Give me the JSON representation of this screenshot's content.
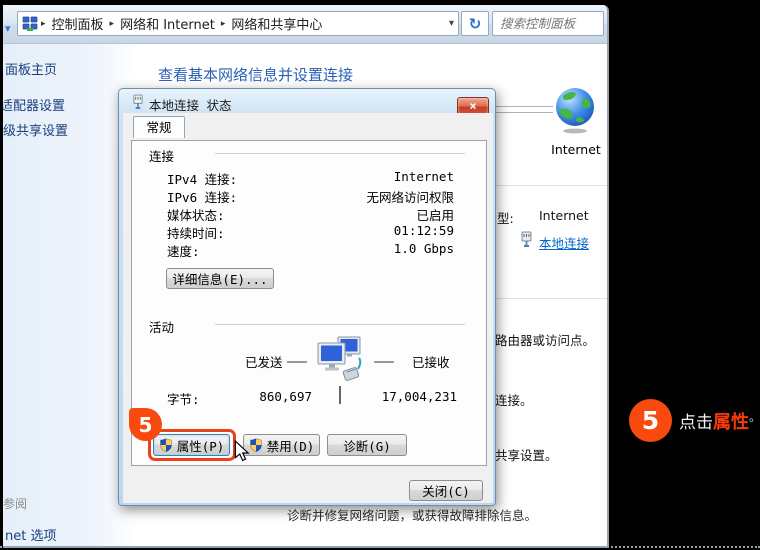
{
  "toolbar": {
    "breadcrumb": [
      "控制面板",
      "网络和 Internet",
      "网络和共享中心"
    ],
    "breadcrumb_sep": "▸",
    "back_dropdown_glyph": "▾",
    "address_dropdown_glyph": "▾",
    "refresh_glyph": "↻",
    "search_placeholder": "搜索控制面板"
  },
  "sidebar": {
    "items": [
      {
        "label": "面板主页"
      },
      {
        "label": "适配器设置"
      },
      {
        "label": "级共享设置"
      }
    ],
    "see_also": "参阅",
    "footer_item": "net 选项"
  },
  "main": {
    "heading": "查看基本网络信息并设置连接",
    "internet_label": "Internet",
    "access_type_label": "型:",
    "access_type_value": "Internet",
    "connection_link": "本地连接",
    "fragments": [
      "路由器或访问点。",
      "连接。",
      "共享设置。"
    ],
    "diagnose_text": "诊断并修复网络问题，或获得故障排除信息。"
  },
  "dialog": {
    "title": "本地连接 状态",
    "close_glyph": "×",
    "tab": "常规",
    "connection": {
      "label": "连接",
      "rows": [
        {
          "label": "IPv4 连接:",
          "value": "Internet"
        },
        {
          "label": "IPv6 连接:",
          "value": "无网络访问权限"
        },
        {
          "label": "媒体状态:",
          "value": "已启用"
        },
        {
          "label": "持续时间:",
          "value": "01:12:59"
        },
        {
          "label": "速度:",
          "value": "1.0 Gbps"
        }
      ],
      "details_button": "详细信息(E)..."
    },
    "activity": {
      "label": "活动",
      "sent_label": "已发送",
      "received_label": "已接收",
      "bytes_label": "字节:",
      "sent_value": "860,697",
      "received_value": "17,004,231"
    },
    "buttons": {
      "properties": "属性(P)",
      "disable": "禁用(D)",
      "diagnose": "诊断(G)",
      "close": "关闭(C)"
    }
  },
  "annotation": {
    "step": "5",
    "action_text": "点击",
    "target_text": "属性",
    "period": "。"
  },
  "colors": {
    "accent_red": "#f8490e",
    "highlight_border": "#e8421a",
    "link_blue": "#0066cc",
    "heading_blue": "#2a5fb8"
  }
}
